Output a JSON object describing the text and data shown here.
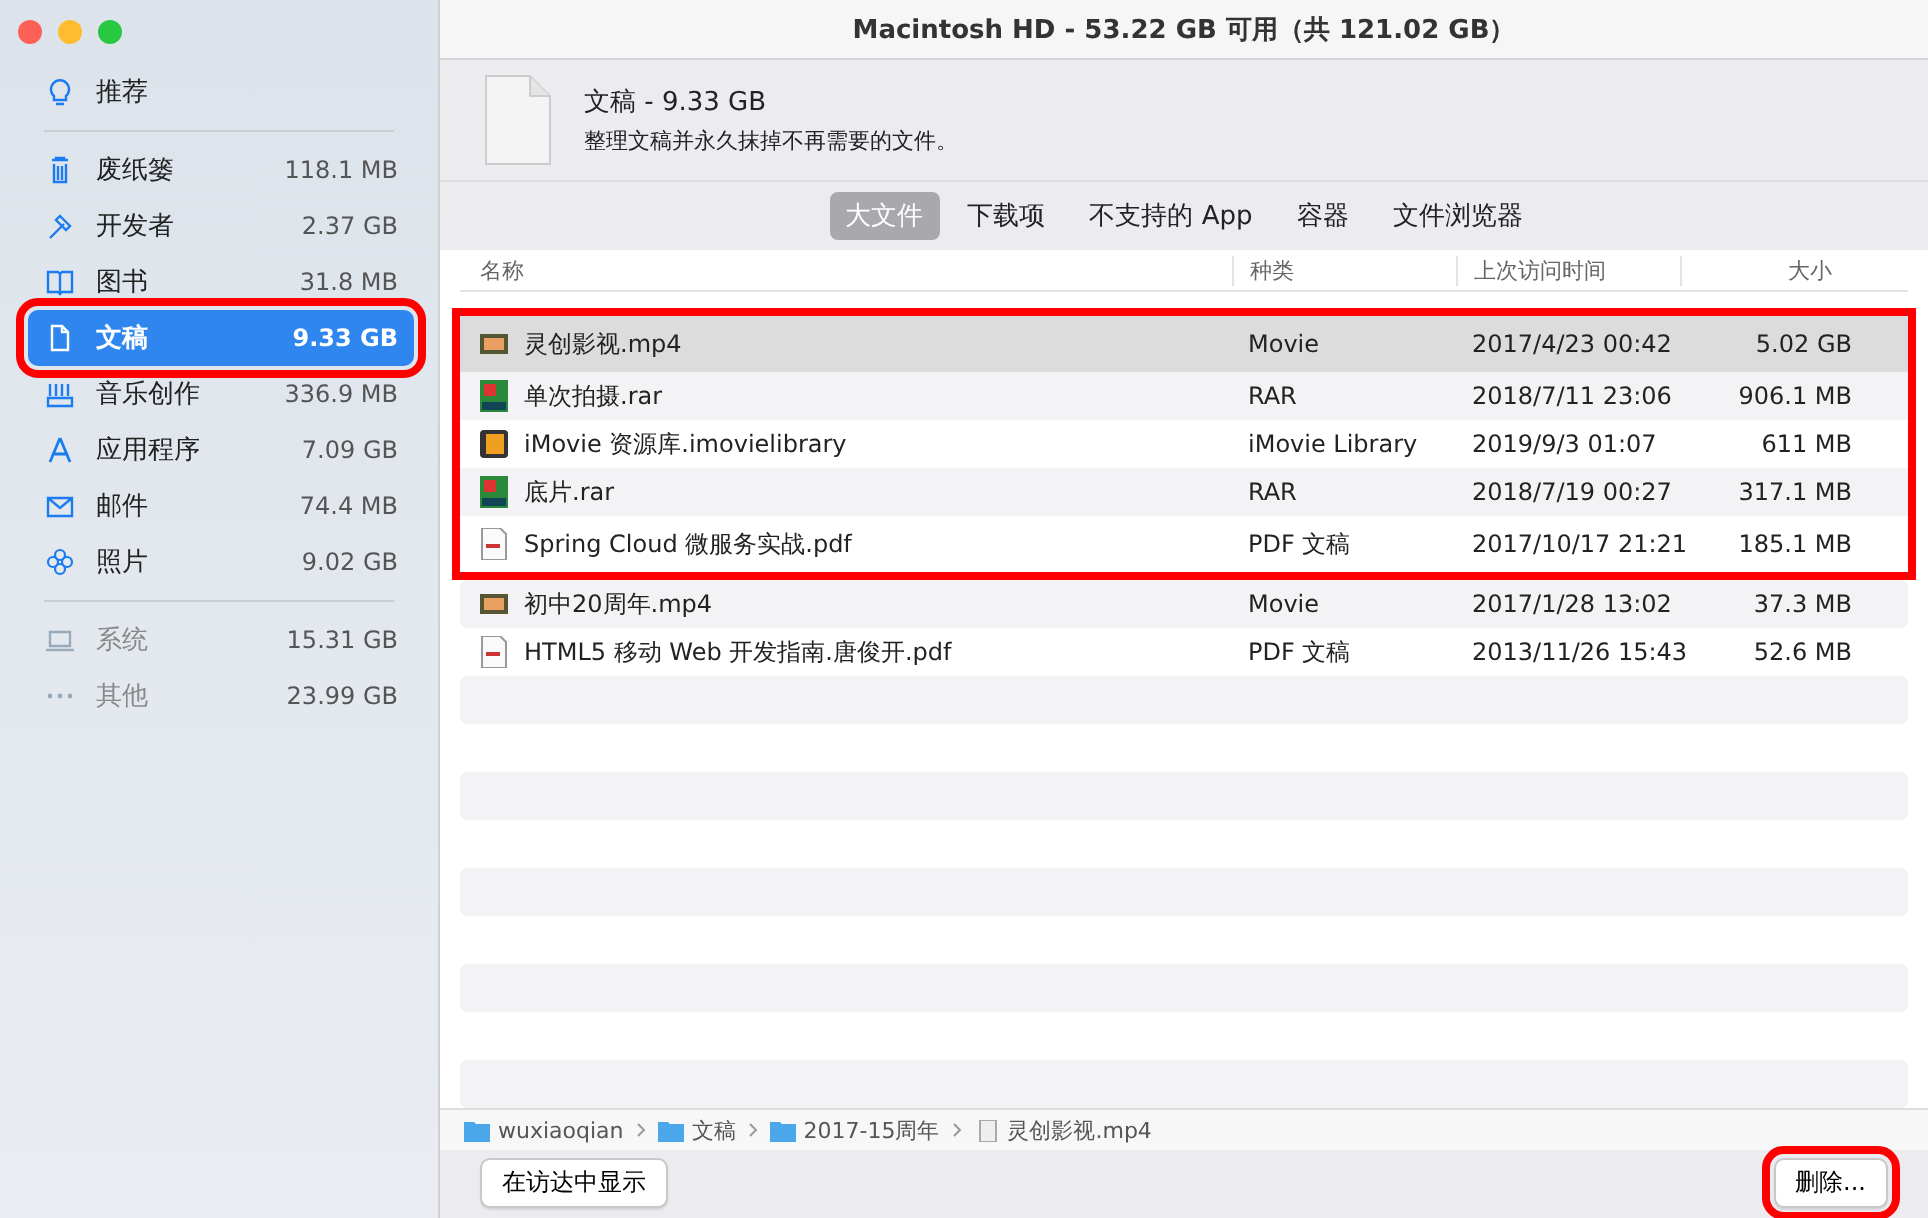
{
  "window": {
    "title": "Macintosh HD - 53.22 GB 可用（共 121.02 GB）"
  },
  "sidebar": {
    "recommended": {
      "label": "推荐"
    },
    "items": [
      {
        "label": "废纸篓",
        "size": "118.1 MB",
        "selected": false,
        "highlighted": false
      },
      {
        "label": "开发者",
        "size": "2.37 GB",
        "selected": false,
        "highlighted": false
      },
      {
        "label": "图书",
        "size": "31.8 MB",
        "selected": false,
        "highlighted": false
      },
      {
        "label": "文稿",
        "size": "9.33 GB",
        "selected": true,
        "highlighted": true
      },
      {
        "label": "音乐创作",
        "size": "336.9 MB",
        "selected": false,
        "highlighted": false
      },
      {
        "label": "应用程序",
        "size": "7.09 GB",
        "selected": false,
        "highlighted": false
      },
      {
        "label": "邮件",
        "size": "74.4 MB",
        "selected": false,
        "highlighted": false
      },
      {
        "label": "照片",
        "size": "9.02 GB",
        "selected": false,
        "highlighted": false
      }
    ],
    "system_items": [
      {
        "label": "系统",
        "size": "15.31 GB"
      },
      {
        "label": "其他",
        "size": "23.99 GB"
      }
    ]
  },
  "header": {
    "title": "文稿 - 9.33 GB",
    "subtitle": "整理文稿并永久抹掉不再需要的文件。"
  },
  "tabs": [
    {
      "label": "大文件",
      "selected": true
    },
    {
      "label": "下载项",
      "selected": false
    },
    {
      "label": "不支持的 App",
      "selected": false
    },
    {
      "label": "容器",
      "selected": false
    },
    {
      "label": "文件浏览器",
      "selected": false
    }
  ],
  "table": {
    "columns": [
      "名称",
      "种类",
      "上次访问时间",
      "大小"
    ],
    "rows": [
      {
        "kind": "video",
        "name": "灵创影视.mp4",
        "type": "Movie",
        "accessed": "2017/4/23 00:42",
        "size": "5.02 GB",
        "selected": true,
        "highlighted": true
      },
      {
        "kind": "archive",
        "name": "单次拍摄.rar",
        "type": "RAR",
        "accessed": "2018/7/11 23:06",
        "size": "906.1 MB",
        "selected": false,
        "highlighted": true
      },
      {
        "kind": "library",
        "name": "iMovie 资源库.imovielibrary",
        "type": "iMovie Library",
        "accessed": "2019/9/3 01:07",
        "size": "611 MB",
        "selected": false,
        "highlighted": true
      },
      {
        "kind": "archive",
        "name": "底片.rar",
        "type": "RAR",
        "accessed": "2018/7/19 00:27",
        "size": "317.1 MB",
        "selected": false,
        "highlighted": true
      },
      {
        "kind": "pdf",
        "name": "Spring Cloud 微服务实战.pdf",
        "type": "PDF 文稿",
        "accessed": "2017/10/17 21:21",
        "size": "185.1 MB",
        "selected": false,
        "highlighted": true
      },
      {
        "kind": "video",
        "name": "初中20周年.mp4",
        "type": "Movie",
        "accessed": "2017/1/28 13:02",
        "size": "37.3 MB",
        "selected": false,
        "highlighted": false
      },
      {
        "kind": "pdf",
        "name": "HTML5 移动 Web 开发指南.唐俊开.pdf",
        "type": "PDF 文稿",
        "accessed": "2013/11/26 15:43",
        "size": "52.6 MB",
        "selected": false,
        "highlighted": false
      }
    ]
  },
  "path": [
    {
      "kind": "home",
      "label": "wuxiaoqian"
    },
    {
      "kind": "folder",
      "label": "文稿"
    },
    {
      "kind": "folder",
      "label": "2017-15周年"
    },
    {
      "kind": "file",
      "label": "灵创影视.mp4"
    }
  ],
  "buttons": {
    "reveal": {
      "label": "在访达中显示"
    },
    "delete": {
      "label": "删除...",
      "highlighted": true
    }
  }
}
